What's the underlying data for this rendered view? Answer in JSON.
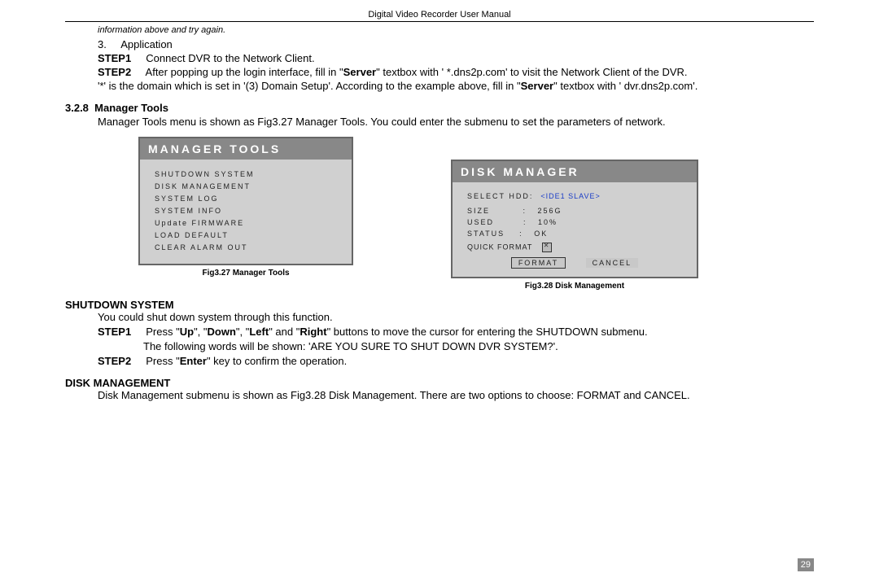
{
  "header": "Digital Video Recorder User Manual",
  "italic_hint": "information above and try again.",
  "app_line_num": "3.",
  "app_line_label": "Application",
  "step1_label": "STEP1",
  "step1_text": "Connect DVR to the Network Client.",
  "step2_label": "STEP2",
  "step2_text_a": "After popping up the login interface, fill in \"",
  "server_word": "Server",
  "step2_text_b": "\" textbox with ' *.dns2p.com' to visit the Network Client of the DVR.",
  "domain_text_a": "'*' is the domain which is set in '(3) Domain Setup'. According to the example above, fill in \"",
  "domain_text_b": "\" textbox with ' dvr.dns2p.com'.",
  "sec_num": "3.2.8",
  "sec_title": "Manager Tools",
  "sec_para": "Manager Tools menu is shown as Fig3.27 Manager Tools. You could enter the submenu to set the parameters of network.",
  "manager_menu": {
    "title": "MANAGER  TOOLS",
    "items": [
      "SHUTDOWN  SYSTEM",
      "DISK  MANAGEMENT",
      "SYSTEM  LOG",
      "SYSTEM  INFO",
      "Update FIRMWARE",
      "LOAD   DEFAULT",
      "CLEAR  ALARM  OUT"
    ],
    "caption": "Fig3.27 Manager Tools"
  },
  "disk_menu": {
    "title": "DISK MANAGER",
    "select_label": "SELECT  HDD:",
    "select_value": "<IDE1 SLAVE>",
    "rows": [
      {
        "k": "SIZE",
        "v": "256G"
      },
      {
        "k": "USED",
        "v": "10%"
      },
      {
        "k": "STATUS",
        "v": "OK"
      }
    ],
    "quick_fmt": "QUICK FORMAT",
    "btn_format": "FORMAT",
    "btn_cancel": "CANCEL",
    "caption": "Fig3.28 Disk Management"
  },
  "shutdown": {
    "heading": "SHUTDOWN SYSTEM",
    "intro": "You could shut down system through this function.",
    "s1a": "Press \"",
    "up": "Up",
    "s1b": "\", \"",
    "down": "Down",
    "s1c": "\", \"",
    "left": "Left",
    "s1d": "\" and \"",
    "right": "Right",
    "s1e": "\" buttons to move the cursor for entering the SHUTDOWN submenu.",
    "warn": "The following words will be shown: 'ARE YOU SURE TO SHUT DOWN DVR SYSTEM?'.",
    "s2a": "Press \"",
    "enter": "Enter",
    "s2b": "\" key to confirm the operation."
  },
  "diskmgmt": {
    "heading": "DISK MANAGEMENT",
    "para": "Disk Management submenu is shown as Fig3.28 Disk Management. There are two options to choose: FORMAT and CANCEL."
  },
  "page_number": "29"
}
